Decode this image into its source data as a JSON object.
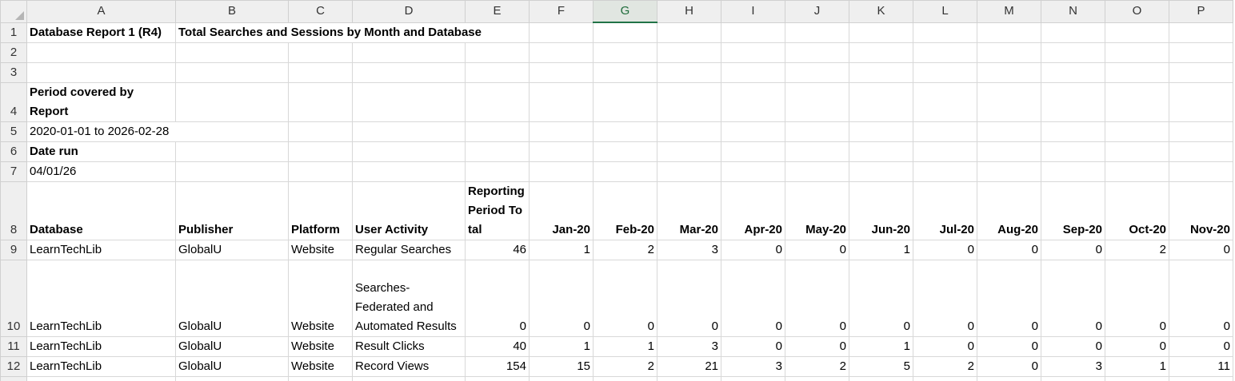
{
  "columns": [
    "A",
    "B",
    "C",
    "D",
    "E",
    "F",
    "G",
    "H",
    "I",
    "J",
    "K",
    "L",
    "M",
    "N",
    "O",
    "P"
  ],
  "selected_column": "G",
  "rows": [
    "1",
    "2",
    "3",
    "4",
    "5",
    "6",
    "7",
    "8",
    "9",
    "10",
    "11",
    "12",
    "13"
  ],
  "report": {
    "name": "Database Report 1 (R4)",
    "title": "Total Searches and Sessions by Month and Database",
    "period_label": "Period covered by Report",
    "period_value": "2020-01-01 to 2026-02-28",
    "date_run_label": "Date run",
    "date_run_value": "04/01/26"
  },
  "table": {
    "headers": [
      "Database",
      "Publisher",
      "Platform",
      "User Activity",
      "Reporting Period Total",
      "Jan-20",
      "Feb-20",
      "Mar-20",
      "Apr-20",
      "May-20",
      "Jun-20",
      "Jul-20",
      "Aug-20",
      "Sep-20",
      "Oct-20",
      "Nov-20"
    ],
    "rows": [
      {
        "database": "LearnTechLib",
        "publisher": "GlobalU",
        "platform": "Website",
        "activity": "Regular Searches",
        "values": [
          "46",
          "1",
          "2",
          "3",
          "0",
          "0",
          "1",
          "0",
          "0",
          "0",
          "2",
          "0"
        ]
      },
      {
        "database": "LearnTechLib",
        "publisher": "GlobalU",
        "platform": "Website",
        "activity": "Searches-Federated and Automated Results",
        "values": [
          "0",
          "0",
          "0",
          "0",
          "0",
          "0",
          "0",
          "0",
          "0",
          "0",
          "0",
          "0"
        ]
      },
      {
        "database": "LearnTechLib",
        "publisher": "GlobalU",
        "platform": "Website",
        "activity": "Result Clicks",
        "values": [
          "40",
          "1",
          "1",
          "3",
          "0",
          "0",
          "1",
          "0",
          "0",
          "0",
          "0",
          "0"
        ]
      },
      {
        "database": "LearnTechLib",
        "publisher": "GlobalU",
        "platform": "Website",
        "activity": "Record Views",
        "values": [
          "154",
          "15",
          "2",
          "21",
          "3",
          "2",
          "5",
          "2",
          "0",
          "3",
          "1",
          "11"
        ]
      }
    ]
  }
}
